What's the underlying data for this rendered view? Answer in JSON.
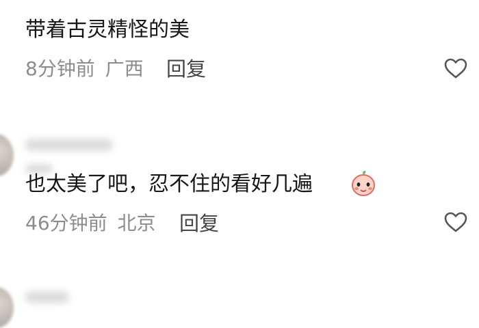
{
  "comments": [
    {
      "text": "带着古灵精怪的美",
      "time": "8分钟前",
      "location": "广西",
      "reply_label": "回复",
      "like_icon": "heart-outline-icon"
    },
    {
      "text": "也太美了吧，忍不住的看好几遍",
      "time": "46分钟前",
      "location": "北京",
      "reply_label": "回复",
      "like_icon": "heart-outline-icon",
      "emoji": "peach-face-emoji"
    }
  ],
  "colors": {
    "comment_text": "#161616",
    "meta_text": "#8c8c8c",
    "reply_text": "#444444",
    "heart_stroke": "#555555"
  }
}
